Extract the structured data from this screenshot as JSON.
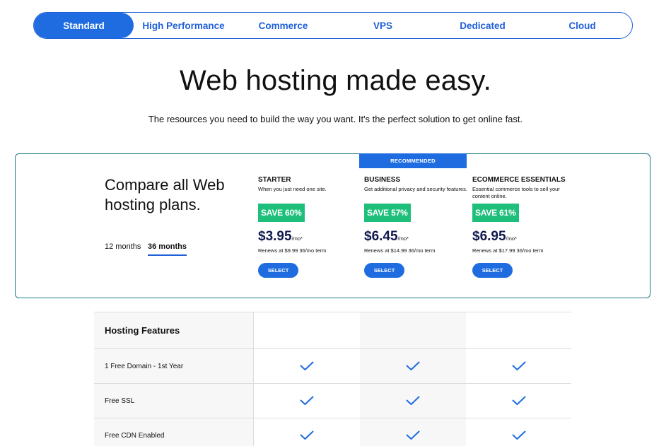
{
  "tabs": [
    "Standard",
    "High Performance",
    "Commerce",
    "VPS",
    "Dedicated",
    "Cloud"
  ],
  "active_tab": "Standard",
  "hero": {
    "title": "Web hosting made easy.",
    "subtitle": "The resources you need to build the way you want. It's the perfect solution to get online fast."
  },
  "compare": {
    "title": "Compare all Web hosting plans.",
    "terms": [
      "12 months",
      "36 months"
    ],
    "selected_term": "36 months",
    "recommended_label": "RECOMMENDED",
    "plans": [
      {
        "name": "STARTER",
        "description": "When you just need one site.",
        "save": "SAVE 60%",
        "price": "$3.95",
        "unit": "/mo*",
        "renews": "Renews at $9.99 36/mo term",
        "select_label": "SELECT"
      },
      {
        "name": "BUSINESS",
        "description": "Get additional privacy and security features.",
        "save": "SAVE 57%",
        "price": "$6.45",
        "unit": "/mo*",
        "renews": "Renews at $14.99 36/mo term",
        "select_label": "SELECT"
      },
      {
        "name": "ECOMMERCE ESSENTIALS",
        "description": "Essential commerce tools to sell your content online.",
        "save": "SAVE 61%",
        "price": "$6.95",
        "unit": "/mo*",
        "renews": "Renews at $17.99 36/mo term",
        "select_label": "SELECT"
      }
    ]
  },
  "features": {
    "header": "Hosting Features",
    "rows": [
      {
        "label": "1 Free Domain - 1st Year",
        "included": [
          true,
          true,
          true
        ]
      },
      {
        "label": "Free SSL",
        "included": [
          true,
          true,
          true
        ]
      },
      {
        "label": "Free CDN Enabled",
        "included": [
          true,
          true,
          true
        ]
      }
    ]
  },
  "colors": {
    "brand_blue": "#1f6ce0",
    "save_green": "#1ebf7b",
    "price_navy": "#121a4e",
    "check_blue": "#1f6ce0"
  },
  "icons": {
    "check": "check-icon"
  }
}
